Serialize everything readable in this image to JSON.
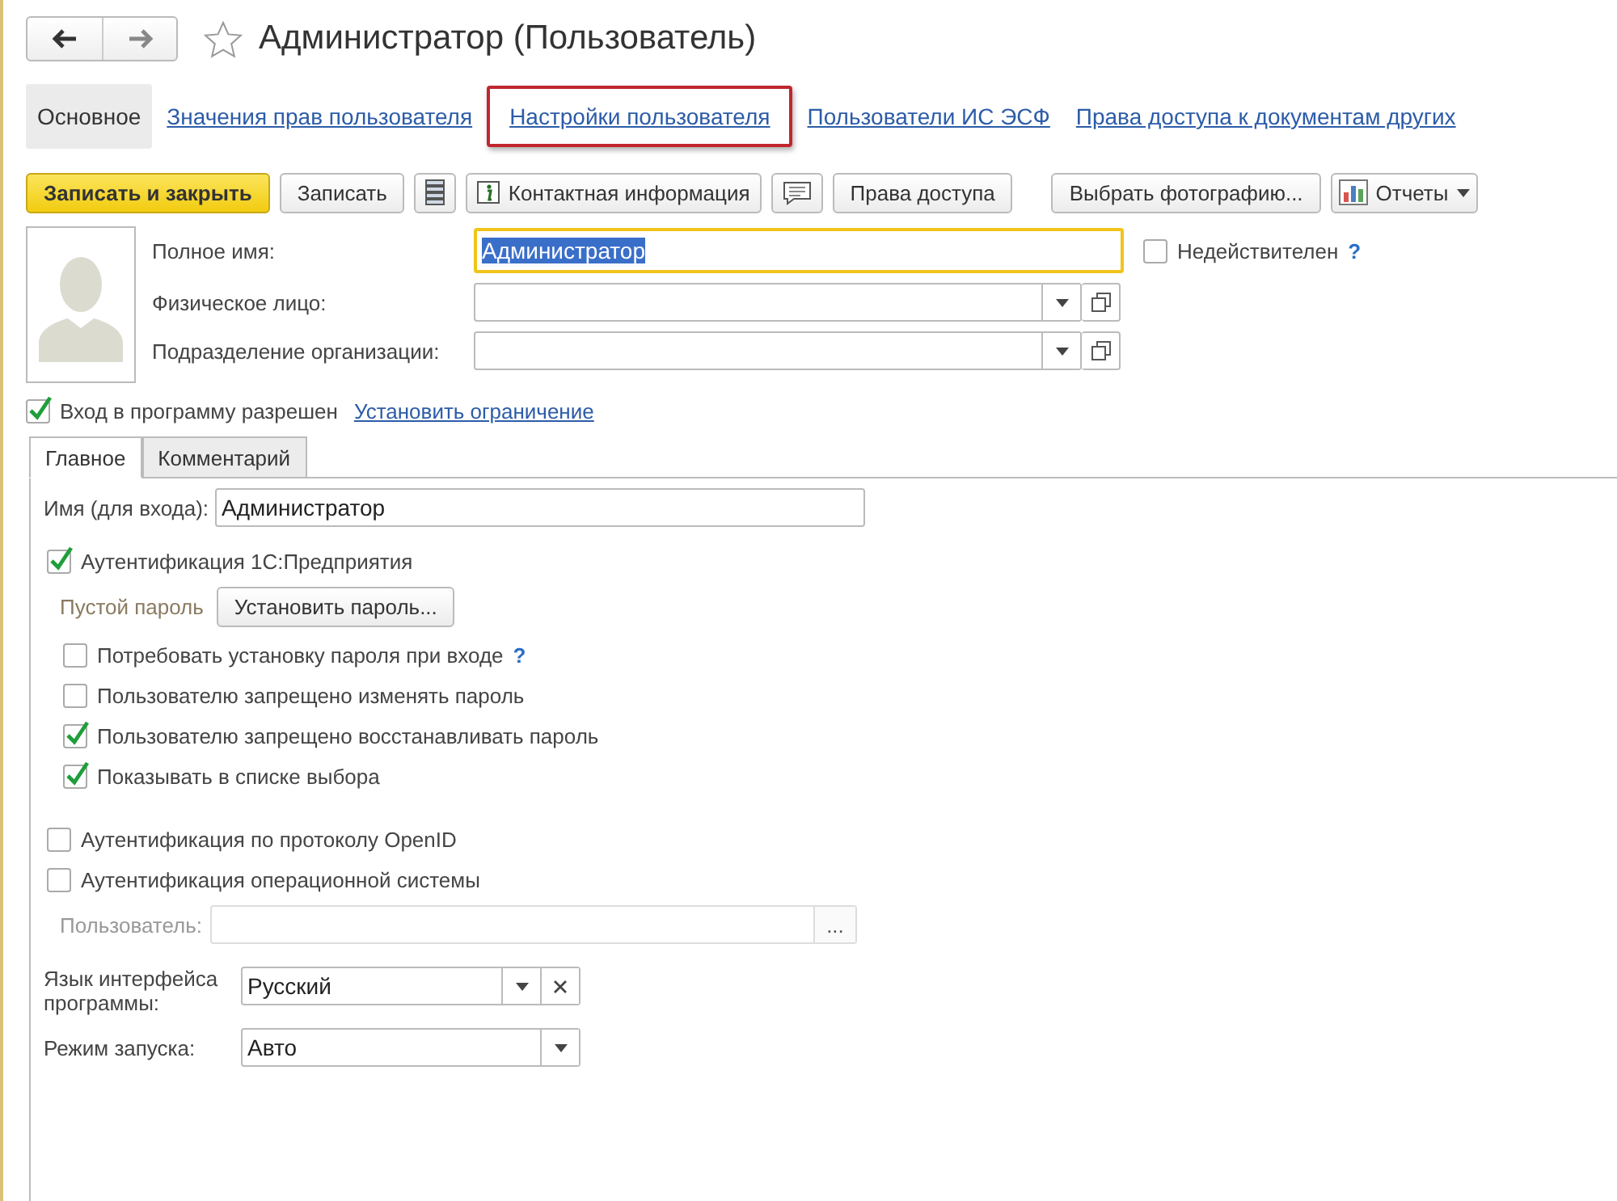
{
  "header": {
    "title": "Администратор (Пользователь)",
    "favorite": false
  },
  "nav": [
    {
      "label": "Основное",
      "selected": true,
      "highlighted": false
    },
    {
      "label": "Значения прав пользователя",
      "selected": false,
      "highlighted": false
    },
    {
      "label": "Настройки пользователя",
      "selected": false,
      "highlighted": true
    },
    {
      "label": "Пользователи ИС ЭСФ",
      "selected": false,
      "highlighted": false
    },
    {
      "label": "Права доступа к документам других",
      "selected": false,
      "highlighted": false
    }
  ],
  "toolbar": [
    {
      "kind": "primary",
      "label": "Записать и закрыть"
    },
    {
      "kind": "plain",
      "label": "Записать"
    },
    {
      "kind": "list"
    },
    {
      "kind": "info",
      "label": "Контактная информация"
    },
    {
      "kind": "comment"
    },
    {
      "kind": "plain",
      "label": "Права доступа"
    },
    {
      "kind": "spacer"
    },
    {
      "kind": "plain",
      "label": "Выбрать фотографию..."
    },
    {
      "kind": "reports",
      "label": "Отчеты"
    }
  ],
  "fields": [
    {
      "kind": "text",
      "label": "Полное имя:",
      "value": "Администратор",
      "focused": true
    },
    {
      "kind": "select",
      "label": "Физическое лицо:"
    },
    {
      "kind": "select",
      "label": "Подразделение организации:"
    }
  ],
  "invalid": {
    "label": "Недействителен",
    "checked": false,
    "help": "?"
  },
  "login_allowed": {
    "label": "Вход в программу разрешен",
    "checked": true,
    "link": "Установить ограничение"
  },
  "tabs": [
    {
      "label": "Главное",
      "selected": true
    },
    {
      "label": "Комментарий",
      "selected": false
    }
  ],
  "login_name": {
    "label": "Имя (для входа):",
    "value": "Администратор"
  },
  "auth_1c": {
    "label": "Аутентификация 1С:Предприятия",
    "checked": true
  },
  "password": {
    "status": "Пустой пароль",
    "button": "Установить пароль..."
  },
  "options": [
    {
      "label": "Потребовать установку пароля при входе",
      "checked": false,
      "help": "?"
    },
    {
      "label": "Пользователю запрещено изменять пароль",
      "checked": false
    },
    {
      "label": "Пользователю запрещено восстанавливать пароль",
      "checked": true
    },
    {
      "label": "Показывать в списке выбора",
      "checked": true
    }
  ],
  "auth_other": [
    {
      "label": "Аутентификация по протоколу OpenID",
      "checked": false
    },
    {
      "label": "Аутентификация операционной системы",
      "checked": false
    }
  ],
  "os_user": {
    "label": "Пользователь:",
    "disabled": true,
    "button": "..."
  },
  "language": {
    "label": "Язык интерфейса программы:",
    "value": "Русский",
    "clearable": true
  },
  "launch_mode": {
    "label": "Режим запуска:",
    "value": "Авто"
  }
}
